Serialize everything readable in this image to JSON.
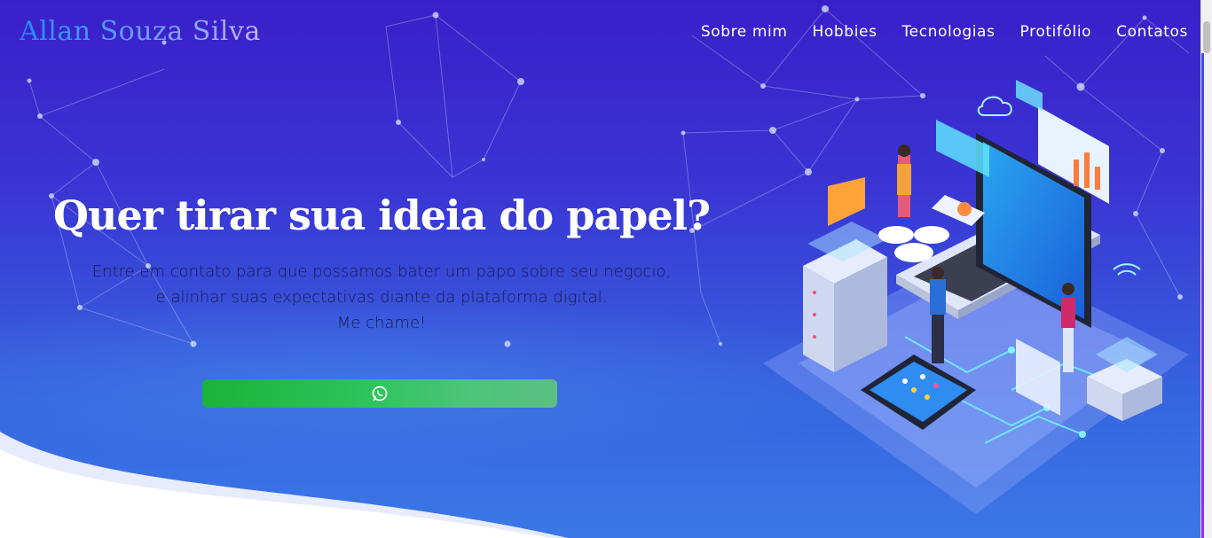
{
  "brand": {
    "name": "Allan Souza Silva"
  },
  "nav": {
    "items": [
      {
        "label": "Sobre mim"
      },
      {
        "label": "Hobbies"
      },
      {
        "label": "Tecnologias"
      },
      {
        "label": "Protifólio"
      },
      {
        "label": "Contatos"
      }
    ]
  },
  "hero": {
    "headline": "Quer tirar sua ideia do papel?",
    "lines": [
      "Entre em contato para que possamos bater um papo sobre seu negocio,",
      "e alinhar suas expectativas diante da plataforma digital.",
      "Me chame!"
    ],
    "button_icon": "whatsapp-icon"
  },
  "colors": {
    "background_top": "#3a1fc8",
    "background_bottom": "#3b78e6",
    "button_green": "#1ab33a",
    "text_dark": "#1b1c4a"
  }
}
